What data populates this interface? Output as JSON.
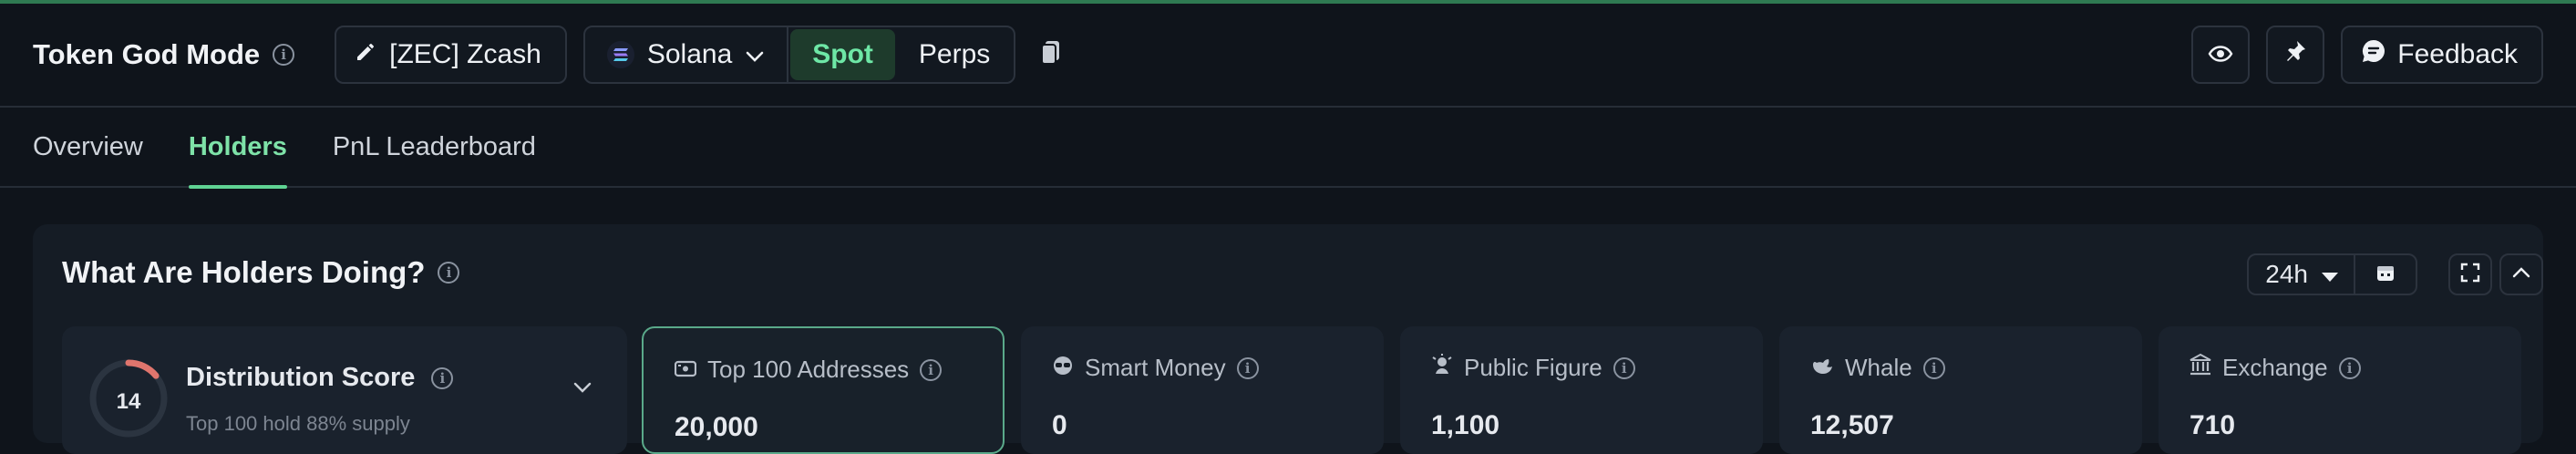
{
  "header": {
    "title": "Token God Mode",
    "token_label": "[ZEC] Zcash",
    "chain_label": "Solana",
    "spot_label": "Spot",
    "perps_label": "Perps",
    "feedback_label": "Feedback"
  },
  "tabs": [
    {
      "label": "Overview",
      "active": false
    },
    {
      "label": "Holders",
      "active": true
    },
    {
      "label": "PnL Leaderboard",
      "active": false
    }
  ],
  "panel": {
    "title": "What Are Holders Doing?",
    "range_label": "24h"
  },
  "distribution": {
    "score": "14",
    "title": "Distribution Score",
    "subtitle": "Top 100 hold 88% supply"
  },
  "cards": [
    {
      "label": "Top 100 Addresses",
      "icon": "wallet-icon",
      "value": "20,000"
    },
    {
      "label": "Smart Money",
      "icon": "smart-money-icon",
      "value": "0"
    },
    {
      "label": "Public Figure",
      "icon": "public-figure-icon",
      "value": "1,100"
    },
    {
      "label": "Whale",
      "icon": "whale-icon",
      "value": "12,507"
    },
    {
      "label": "Exchange",
      "icon": "bank-icon",
      "value": "710"
    }
  ],
  "colors": {
    "accent": "#5fd393",
    "background": "#0f141b",
    "panel": "#151c25",
    "gauge": "#e0756d"
  }
}
